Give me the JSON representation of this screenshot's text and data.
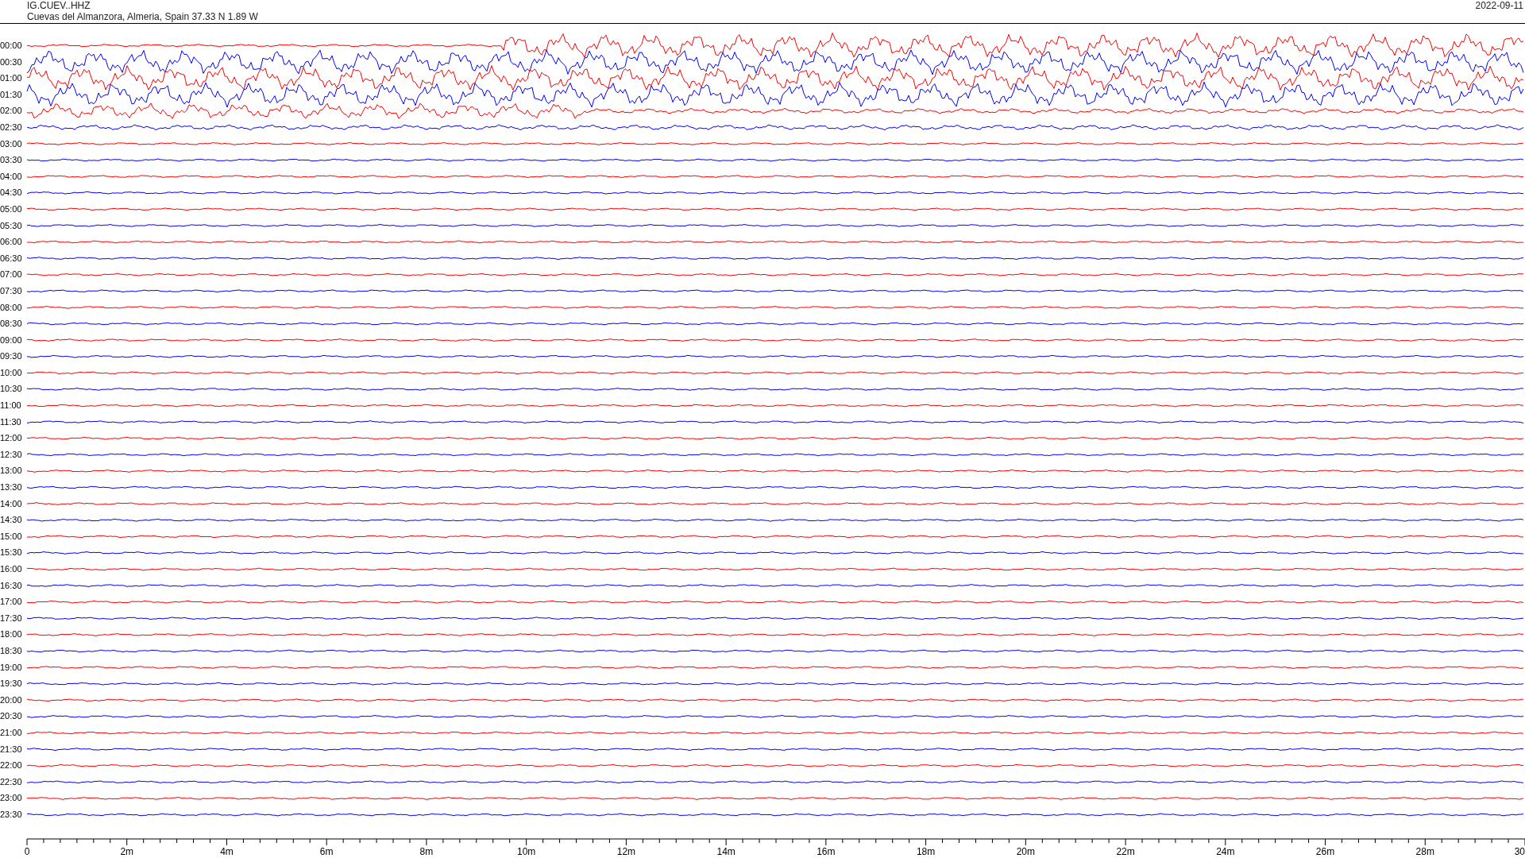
{
  "header": {
    "station": "IG.CUEV..HHZ",
    "location": "Cuevas del Almanzora, Almeria, Spain  37.33 N 1.89 W",
    "date": "2022-09-11"
  },
  "traces": [
    {
      "label": "00:00",
      "color": "#ff0000"
    },
    {
      "label": "00:30",
      "color": "#0000ff"
    },
    {
      "label": "01:00",
      "color": "#ff0000"
    },
    {
      "label": "01:30",
      "color": "#0000ff"
    },
    {
      "label": "02:00",
      "color": "#ff0000"
    },
    {
      "label": "02:30",
      "color": "#0000ff"
    },
    {
      "label": "03:00",
      "color": "#ff0000"
    },
    {
      "label": "03:30",
      "color": "#0000ff"
    },
    {
      "label": "04:00",
      "color": "#ff0000"
    },
    {
      "label": "04:30",
      "color": "#0000ff"
    },
    {
      "label": "05:00",
      "color": "#ff0000"
    },
    {
      "label": "05:30",
      "color": "#0000ff"
    },
    {
      "label": "06:00",
      "color": "#ff0000"
    },
    {
      "label": "06:30",
      "color": "#0000ff"
    },
    {
      "label": "07:00",
      "color": "#ff0000"
    },
    {
      "label": "07:30",
      "color": "#0000ff"
    },
    {
      "label": "08:00",
      "color": "#ff0000"
    },
    {
      "label": "08:30",
      "color": "#0000ff"
    },
    {
      "label": "09:00",
      "color": "#ff0000"
    },
    {
      "label": "09:30",
      "color": "#0000ff"
    },
    {
      "label": "10:00",
      "color": "#ff0000"
    },
    {
      "label": "10:30",
      "color": "#0000ff"
    },
    {
      "label": "11:00",
      "color": "#ff0000"
    },
    {
      "label": "11:30",
      "color": "#0000ff"
    },
    {
      "label": "12:00",
      "color": "#ff0000"
    },
    {
      "label": "12:30",
      "color": "#0000ff"
    },
    {
      "label": "13:00",
      "color": "#ff0000"
    },
    {
      "label": "13:30",
      "color": "#0000ff"
    },
    {
      "label": "14:00",
      "color": "#ff0000"
    },
    {
      "label": "14:30",
      "color": "#0000ff"
    },
    {
      "label": "15:00",
      "color": "#ff0000"
    },
    {
      "label": "15:30",
      "color": "#0000ff"
    },
    {
      "label": "16:00",
      "color": "#ff0000"
    },
    {
      "label": "16:30",
      "color": "#0000ff"
    },
    {
      "label": "17:00",
      "color": "#ff0000"
    },
    {
      "label": "17:30",
      "color": "#0000ff"
    },
    {
      "label": "18:00",
      "color": "#ff0000"
    },
    {
      "label": "18:30",
      "color": "#0000ff"
    },
    {
      "label": "19:00",
      "color": "#ff0000"
    },
    {
      "label": "19:30",
      "color": "#0000ff"
    },
    {
      "label": "20:00",
      "color": "#ff0000"
    },
    {
      "label": "20:30",
      "color": "#0000ff"
    },
    {
      "label": "21:00",
      "color": "#ff0000"
    },
    {
      "label": "21:30",
      "color": "#0000ff"
    },
    {
      "label": "22:00",
      "color": "#ff0000"
    },
    {
      "label": "22:30",
      "color": "#0000ff"
    },
    {
      "label": "23:00",
      "color": "#ff0000"
    },
    {
      "label": "23:30",
      "color": "#0000ff"
    }
  ],
  "x_axis": {
    "labels": [
      "0",
      "2m",
      "4m",
      "6m",
      "8m",
      "10m",
      "12m",
      "14m",
      "16m",
      "18m",
      "20m",
      "22m",
      "24m",
      "26m",
      "28m",
      "30"
    ]
  }
}
